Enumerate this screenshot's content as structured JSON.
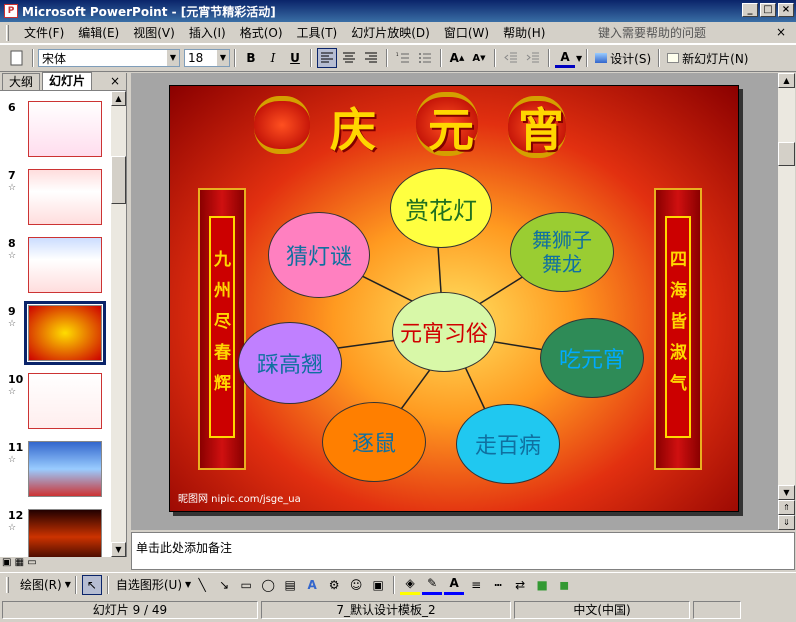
{
  "window": {
    "title": "Microsoft PowerPoint - [元宵节精彩活动]",
    "app_icon": "P"
  },
  "menu": {
    "items": [
      "文件(F)",
      "编辑(E)",
      "视图(V)",
      "插入(I)",
      "格式(O)",
      "工具(T)",
      "幻灯片放映(D)",
      "窗口(W)",
      "帮助(H)"
    ],
    "help_placeholder": "键入需要帮助的问题"
  },
  "toolbar": {
    "font_name": "宋体",
    "font_size": "18",
    "bold": "B",
    "italic": "I",
    "underline": "U",
    "design_label": "设计(S)",
    "new_slide_label": "新幻灯片(N)"
  },
  "panel": {
    "tab_outline": "大纲",
    "tab_slides": "幻灯片"
  },
  "thumbnails": [
    {
      "num": "6",
      "star": ""
    },
    {
      "num": "7",
      "star": "☆"
    },
    {
      "num": "8",
      "star": "☆"
    },
    {
      "num": "9",
      "star": "☆"
    },
    {
      "num": "10",
      "star": "☆"
    },
    {
      "num": "11",
      "star": "☆"
    },
    {
      "num": "12",
      "star": "☆"
    }
  ],
  "slide": {
    "title_chars": [
      "庆",
      "元",
      "宵"
    ],
    "left_couplet": "九州尽春辉",
    "right_couplet": "四海皆淑气",
    "center": "元宵习俗",
    "nodes": {
      "n1": "赏花灯",
      "n2": "舞狮子舞龙",
      "n3": "猜灯谜",
      "n4": "踩高翘",
      "n5": "吃元宵",
      "n6": "逐鼠",
      "n7": "走百病"
    },
    "watermark": "昵图网 nipic.com/jsge_ua"
  },
  "notes": {
    "placeholder": "单击此处添加备注"
  },
  "drawbar": {
    "draw_label": "绘图(R)",
    "autoshape_label": "自选图形(U)"
  },
  "status": {
    "slide_info": "幻灯片 9 / 49",
    "template": "7_默认设计模板_2",
    "language": "中文(中国)"
  },
  "colors": {
    "title_bar": "#0a246a",
    "accent_gold": "#ffd700",
    "slide_red": "#c00000"
  }
}
